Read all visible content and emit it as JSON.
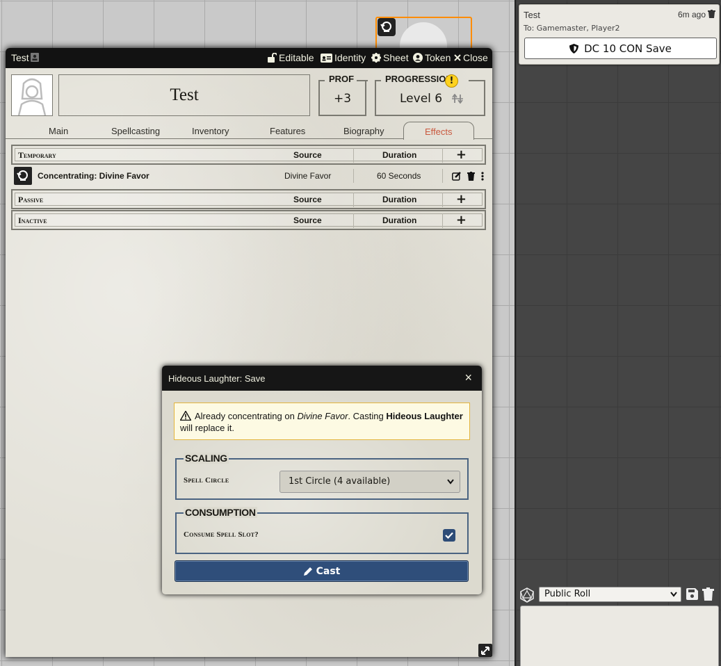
{
  "chat": {
    "author": "Test",
    "time": "6m ago",
    "recipients": "To: Gamemaster, Player2",
    "save_button_label": "DC 10 CON Save",
    "roll_mode": "Public Roll"
  },
  "sheet": {
    "title": "Test",
    "header_buttons": {
      "editable": "Editable",
      "identity": "Identity",
      "sheet": "Sheet",
      "token": "Token",
      "close": "Close"
    },
    "name": "Test",
    "prof_label": "PROF",
    "prof_value": "+3",
    "progression_label": "PROGRESSION",
    "progression_warning": "!",
    "level": "Level 6",
    "tabs": [
      "Main",
      "Spellcasting",
      "Inventory",
      "Features",
      "Biography",
      "Effects"
    ],
    "active_tab": "Effects",
    "effects": {
      "col_source": "Source",
      "col_duration": "Duration",
      "add_symbol": "+",
      "groups": {
        "temporary": "Temporary",
        "passive": "Passive",
        "inactive": "Inactive"
      },
      "rows": [
        {
          "name": "Concentrating: Divine Favor",
          "source": "Divine Favor",
          "duration": "60 Seconds"
        }
      ]
    }
  },
  "dialog": {
    "title": "Hideous Laughter: Save",
    "close": "×",
    "notice": {
      "prefix": "Already concentrating on ",
      "current_spell": "Divine Favor",
      "middle": ". Casting ",
      "new_spell": "Hideous Laughter",
      "suffix": " will replace it."
    },
    "scaling_legend": "SCALING",
    "spell_circle_label": "Spell Circle",
    "spell_circle_value": "1st Circle (4 available)",
    "consumption_legend": "CONSUMPTION",
    "consume_label": "Consume Spell Slot?",
    "consume_checked": true,
    "cast_label": "Cast"
  },
  "colors": {
    "accent_blue": "#2f4e7a",
    "token_border": "#ff8c00",
    "warning_yellow": "#ffd21f",
    "active_tab": "#c9593f"
  }
}
